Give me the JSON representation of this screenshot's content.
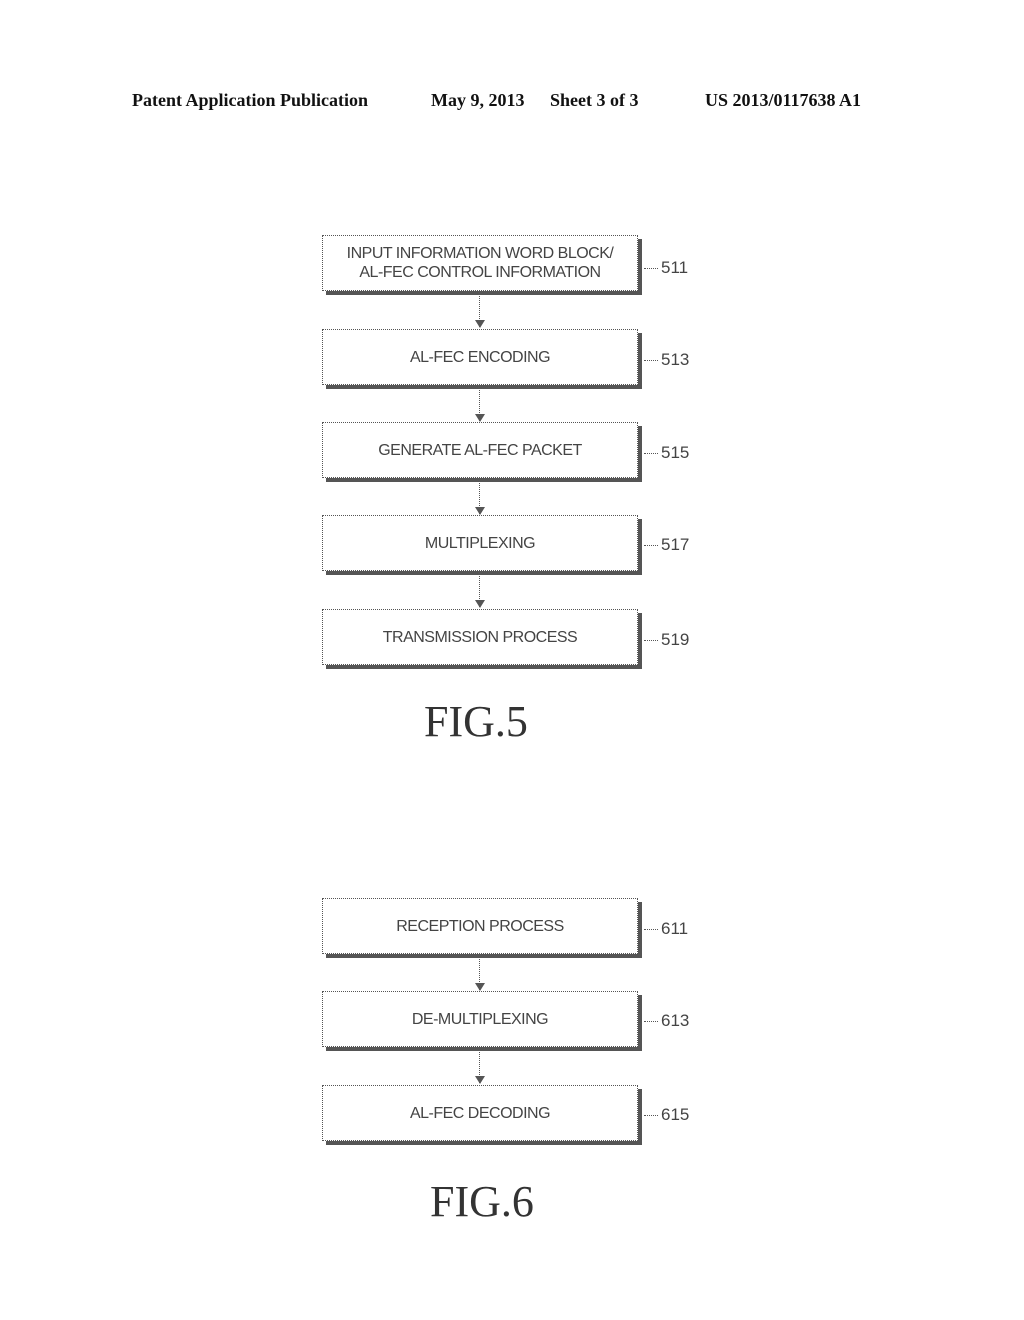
{
  "header": {
    "publication": "Patent Application Publication",
    "date": "May 9, 2013",
    "sheet": "Sheet 3 of 3",
    "number": "US 2013/0117638 A1"
  },
  "fig5": {
    "label": "FIG.5",
    "steps": [
      {
        "line1": "INPUT INFORMATION WORD BLOCK/",
        "line2": "AL-FEC CONTROL INFORMATION",
        "ref": "511"
      },
      {
        "line1": "AL-FEC ENCODING",
        "ref": "513"
      },
      {
        "line1": "GENERATE AL-FEC PACKET",
        "ref": "515"
      },
      {
        "line1": "MULTIPLEXING",
        "ref": "517"
      },
      {
        "line1": "TRANSMISSION PROCESS",
        "ref": "519"
      }
    ]
  },
  "fig6": {
    "label": "FIG.6",
    "steps": [
      {
        "line1": "RECEPTION PROCESS",
        "ref": "611"
      },
      {
        "line1": "DE-MULTIPLEXING",
        "ref": "613"
      },
      {
        "line1": "AL-FEC DECODING",
        "ref": "615"
      }
    ]
  }
}
